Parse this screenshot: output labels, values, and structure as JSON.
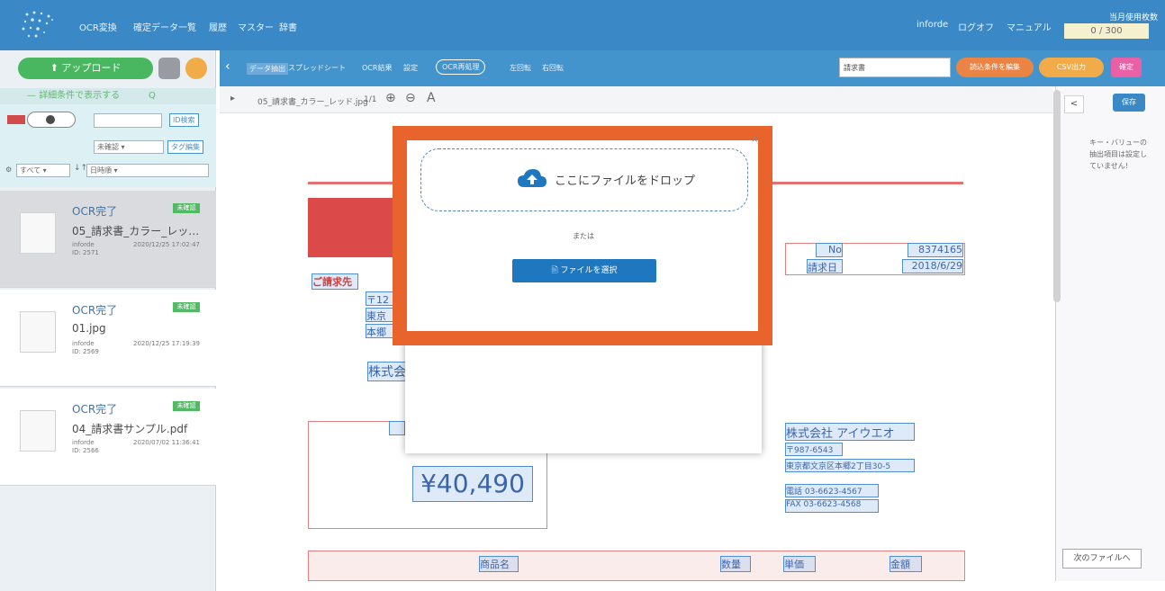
{
  "topbar": {
    "nav": [
      "OCR変換",
      "確定データ一覧",
      "履歴",
      "マスター",
      "辞書"
    ],
    "user": "inforde",
    "logout": "ログオフ",
    "manual": "マニュアル",
    "usage_label": "当月使用枚数",
    "usage_value": "0 / 300"
  },
  "left": {
    "upload": "アップロード",
    "search_toggle": "詳細条件で表示する",
    "id_search": "ID検索",
    "unconfirmed": "未確認",
    "tag_edit": "タグ編集",
    "filter_all": "すべて",
    "sort": "日時順"
  },
  "cards": [
    {
      "status": "OCR完了",
      "badge": "未確認",
      "name": "05_請求書_カラー_レッ…",
      "user": "inforde",
      "id": "ID: 2571",
      "date": "2020/12/25 17:02:47"
    },
    {
      "status": "OCR完了",
      "badge": "未確認",
      "name": "01.jpg",
      "user": "inforde",
      "id": "ID: 2569",
      "date": "2020/12/25 17:19:39"
    },
    {
      "status": "OCR完了",
      "badge": "未確認",
      "name": "04_請求書サンプル.pdf",
      "user": "inforde",
      "id": "ID: 2566",
      "date": "2020/07/02 11:36:41"
    }
  ],
  "toolbar": {
    "items": [
      "データ抽出",
      "スプレッドシート",
      "OCR結果",
      "設定",
      "OCR再処理",
      "左回転",
      "右回転"
    ],
    "select_value": "請求書",
    "pill1": "読込条件を編集",
    "pill2": "CSV出力",
    "pill3": "確定"
  },
  "subbar": {
    "filename": "05_請求書_カラー_レッド.jpg",
    "page": "1/1"
  },
  "right": {
    "back": "<",
    "button": "保存",
    "note": "キー・バリューの抽出項目は設定していません!",
    "next": "次のファイルへ"
  },
  "doc": {
    "no_label": "No",
    "no_value": "8374165",
    "date_label": "請求日",
    "date_value": "2018/6/29",
    "to_label": "ご請求先",
    "zip": "〒12",
    "addr1": "東京",
    "addr2": "本郷",
    "company_partial": "株式会",
    "amount": "¥40,490",
    "company": "株式会社 アイウエオ",
    "zip2": "〒987-6543",
    "address": "東京都文京区本郷2丁目30-5",
    "tel": "電話 03-6623-4567",
    "fax": "FAX 03-6623-4568",
    "col1": "商品名",
    "col2": "数量",
    "col3": "単価",
    "col4": "金額"
  },
  "modal": {
    "drop_text": "ここにファイルをドロップ",
    "or": "または",
    "select_file": "ファイルを選択",
    "close": "×"
  },
  "colors": {
    "primary": "#1f78bf",
    "accent": "#e8642c",
    "green": "#2fae4a"
  }
}
